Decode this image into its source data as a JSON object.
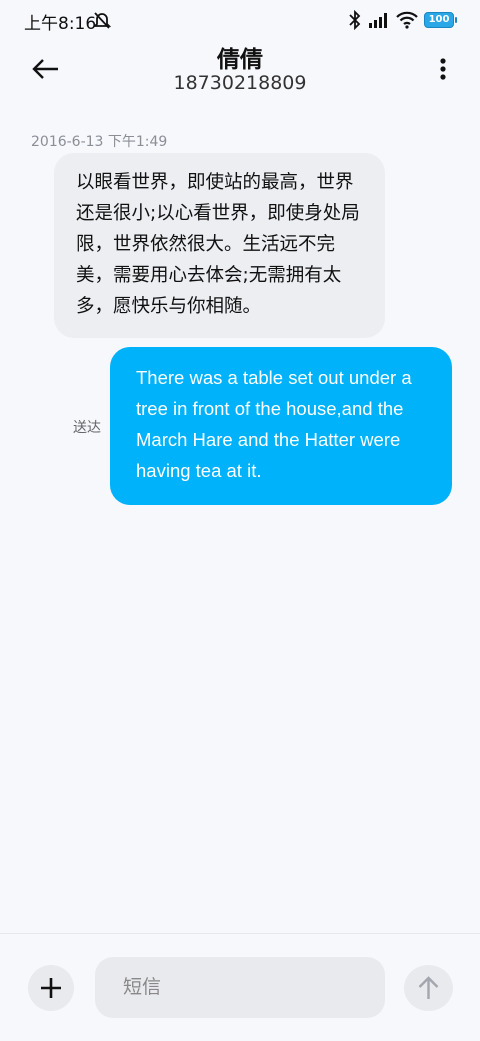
{
  "status_bar": {
    "time": "上午8:16",
    "battery": "100",
    "icons": [
      "mute-icon",
      "bluetooth-icon",
      "signal-icon",
      "wifi-icon",
      "battery-icon"
    ]
  },
  "header": {
    "contact_name": "倩倩",
    "phone_number": "18730218809",
    "icons": [
      "back-arrow-icon",
      "more-vertical-icon"
    ]
  },
  "conversation": {
    "timestamp": "2016-6-13 下午1:49",
    "messages": [
      {
        "direction": "incoming",
        "text": "以眼看世界，即使站的最高，世界还是很小;以心看世界，即使身处局限，世界依然很大。生活远不完美，需要用心去体会;无需拥有太多，愿快乐与你相随。"
      },
      {
        "direction": "outgoing",
        "text": "There was a table set out under a tree in front of the house,and the March Hare and the Hatter were having tea at it.",
        "status": "送达"
      }
    ]
  },
  "composer": {
    "placeholder": "短信",
    "icons": [
      "plus-icon",
      "send-arrow-icon"
    ]
  },
  "colors": {
    "background": "#f7f8fc",
    "incoming_bubble": "#eceef2",
    "outgoing_bubble": "#00b2f9",
    "accent": "#00b2f9"
  }
}
